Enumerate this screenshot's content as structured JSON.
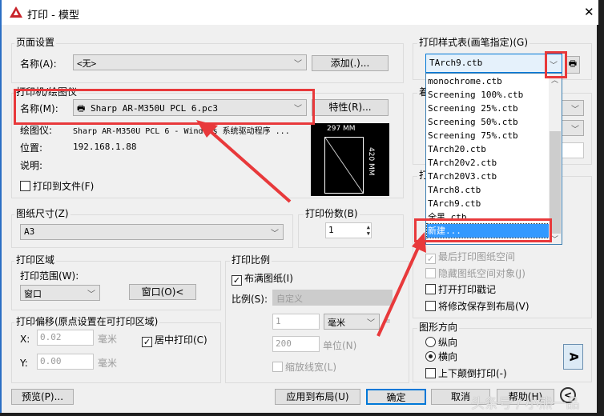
{
  "window": {
    "title": "打印 - 模型",
    "close": "✕"
  },
  "page_setup": {
    "title": "页面设置",
    "name_label": "名称(A):",
    "name_value": "<无>",
    "add_button": "添加(.)..."
  },
  "printer": {
    "title": "打印机/绘图仪",
    "name_label": "名称(M):",
    "name_value": "Sharp AR-M350U PCL 6.pc3",
    "properties_button": "特性(R)...",
    "plotter_label": "绘图仪:",
    "plotter_value": "Sharp AR-M350U PCL 6 - Windows 系统驱动程序 ...",
    "location_label": "位置:",
    "location_value": "192.168.1.88",
    "description_label": "说明:",
    "print_to_file": "打印到文件(F)",
    "preview_width": "297 MM",
    "preview_height": "420 MM"
  },
  "paper_size": {
    "title": "图纸尺寸(Z)",
    "value": "A3"
  },
  "copies": {
    "title": "打印份数(B)",
    "value": "1"
  },
  "plot_area": {
    "title": "打印区域",
    "range_label": "打印范围(W):",
    "range_value": "窗口",
    "window_button": "窗口(O)<"
  },
  "plot_offset": {
    "title": "打印偏移(原点设置在可打印区域)",
    "x_label": "X:",
    "x_value": "0.02",
    "y_label": "Y:",
    "y_value": "0.00",
    "unit": "毫米",
    "center_label": "居中打印(C)"
  },
  "plot_scale": {
    "title": "打印比例",
    "fit_label": "布满图纸(I)",
    "scale_label": "比例(S):",
    "scale_value": "自定义",
    "value1": "1",
    "unit_value": "毫米",
    "equals": "=",
    "value2": "200",
    "units_label": "单位(N)",
    "scale_lineweights": "缩放线宽(L)"
  },
  "plot_style": {
    "title": "打印样式表(画笔指定)(G)",
    "value": "TArch9.ctb",
    "options": [
      "monochrome.ctb",
      "Screening 100%.ctb",
      "Screening 25%.ctb",
      "Screening 50%.ctb",
      "Screening 75%.ctb",
      "TArch20.ctb",
      "TArch20v2.ctb",
      "TArch20V3.ctb",
      "TArch8.ctb",
      "TArch9.ctb",
      "全黑.ctb",
      "新建..."
    ]
  },
  "shaded_viewport": {
    "title_partial": "着"
  },
  "plot_options": {
    "title_partial": "打",
    "last_paperspace": "最后打印图纸空间",
    "hide_paperspace": "隐藏图纸空间对象(J)",
    "plot_stamp": "打开打印戳记",
    "save_changes": "将修改保存到布局(V)"
  },
  "orientation": {
    "title": "图形方向",
    "portrait": "纵向",
    "landscape": "横向",
    "upside_down": "上下颠倒打印(-)",
    "icon_letter": "A"
  },
  "buttons": {
    "preview": "预览(P)...",
    "apply": "应用到布局(U)",
    "ok": "确定",
    "cancel": "取消",
    "help": "帮助(H)",
    "more": "<"
  },
  "watermark": "头条号 / 小熊一品",
  "colors": {
    "highlight": "#3399ff",
    "annotation": "#e8393b"
  }
}
